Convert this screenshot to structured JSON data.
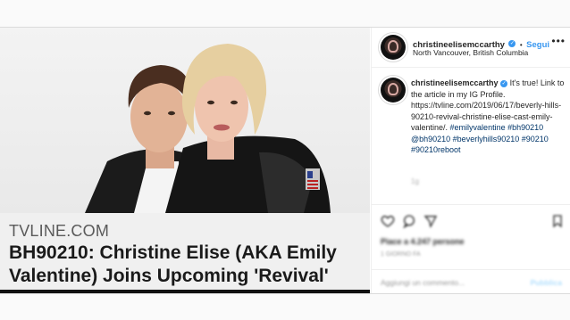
{
  "post": {
    "media": {
      "site_label": "TVLINE.COM",
      "headline": "BH90210: Christine Elise (AKA Emily Valentine) Joins Upcoming 'Revival'"
    },
    "header": {
      "username": "christineelisemccarthy",
      "separator": "•",
      "follow_label": "Segui",
      "location": "North Vancouver, British Columbia",
      "more_icon": "more-options-icon"
    },
    "caption": {
      "username": "christineelisemccarthy",
      "text": "It's true! Link to the article in my IG Profile. https://tvline.com/2019/06/17/beverly-hills-90210-revival-christine-elise-cast-emily-valentine/.",
      "hashtags": "#emilyvalentine #bh90210 @bh90210 #beverlyhills90210 #90210 #90210reboot",
      "timestamp": "1g"
    },
    "engagement": {
      "likes": "Piace a 4.247 persone",
      "age": "1 GIORNO FA",
      "comment_placeholder": "Aggiungi un commento...",
      "publish_label": "Pubblica"
    },
    "colors": {
      "link": "#3897f0",
      "tag": "#003569",
      "text": "#262626"
    }
  }
}
